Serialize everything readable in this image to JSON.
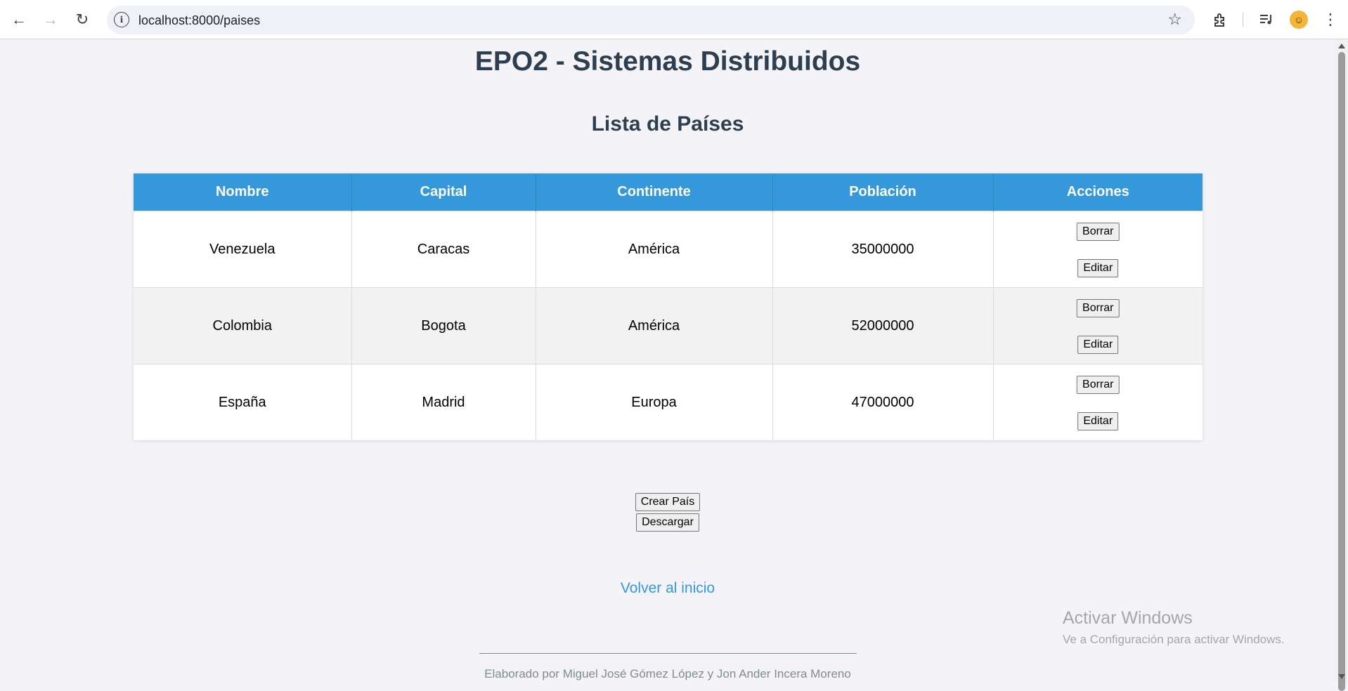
{
  "browser": {
    "url": "localhost:8000/paises",
    "icons": {
      "back": "arrow-left-icon",
      "forward": "arrow-right-icon",
      "reload": "reload-icon",
      "site_info": "info-icon",
      "bookmark": "star-icon",
      "extensions": "puzzle-icon",
      "media": "media-controls-icon",
      "profile": "avatar",
      "menu": "kebab-menu-icon"
    }
  },
  "page": {
    "title": "EPO2 - Sistemas Distribuidos",
    "section_title": "Lista de Países"
  },
  "table": {
    "headers": [
      "Nombre",
      "Capital",
      "Continente",
      "Población",
      "Acciones"
    ],
    "rows": [
      {
        "nombre": "Venezuela",
        "capital": "Caracas",
        "continente": "América",
        "poblacion": "35000000"
      },
      {
        "nombre": "Colombia",
        "capital": "Bogota",
        "continente": "América",
        "poblacion": "52000000"
      },
      {
        "nombre": "España",
        "capital": "Madrid",
        "continente": "Europa",
        "poblacion": "47000000"
      }
    ],
    "delete_label": "Borrar",
    "edit_label": "Editar"
  },
  "actions": {
    "create_label": "Crear País",
    "download_label": "Descargar"
  },
  "back_link": "Volver al inicio",
  "footer": "Elaborado por Miguel José Gómez López y Jon Ander Incera Moreno",
  "watermark": {
    "line1": "Activar Windows",
    "line2": "Ve a Configuración para activar Windows."
  },
  "colors": {
    "header_bg": "#3498db",
    "title": "#2c3e50",
    "link": "#3498db",
    "page_bg": "#f4f4f8"
  }
}
